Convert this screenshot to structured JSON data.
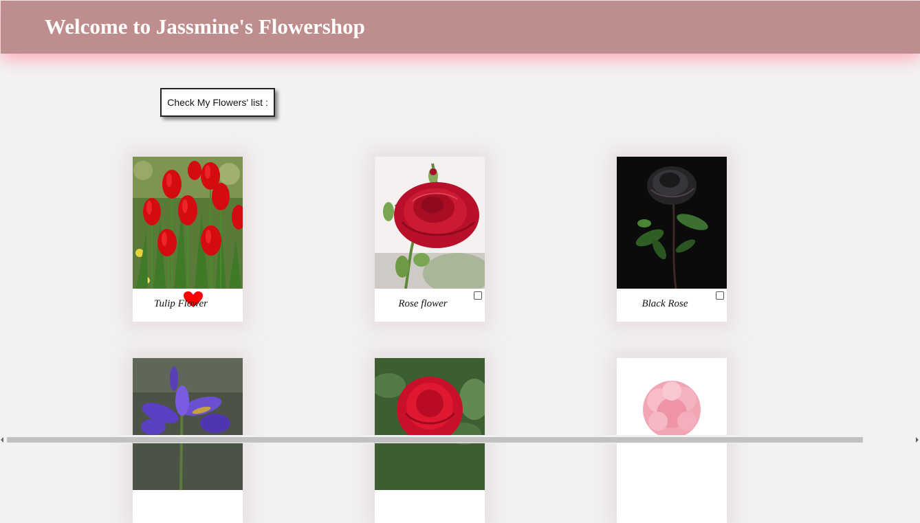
{
  "header": {
    "title": "Welcome to Jassmine's Flowershop"
  },
  "list_button": {
    "label": "Check My Flowers' list :"
  },
  "colors": {
    "header_bg": "#bd8e8d",
    "header_glow": "#ffb6c1",
    "page_bg": "#f3f2f2",
    "favorite_heart": "#ff0000"
  },
  "flowers": [
    {
      "name": "Tulip Flower",
      "favorited": true,
      "image": "red-tulips-photo"
    },
    {
      "name": "Rose flower",
      "favorited": false,
      "image": "red-rose-photo"
    },
    {
      "name": "Black Rose",
      "favorited": false,
      "image": "black-rose-photo"
    },
    {
      "name": "",
      "favorited": false,
      "image": "purple-iris-photo"
    },
    {
      "name": "",
      "favorited": false,
      "image": "red-camellia-photo"
    },
    {
      "name": "",
      "favorited": false,
      "image": "pink-carnation-photo"
    }
  ]
}
